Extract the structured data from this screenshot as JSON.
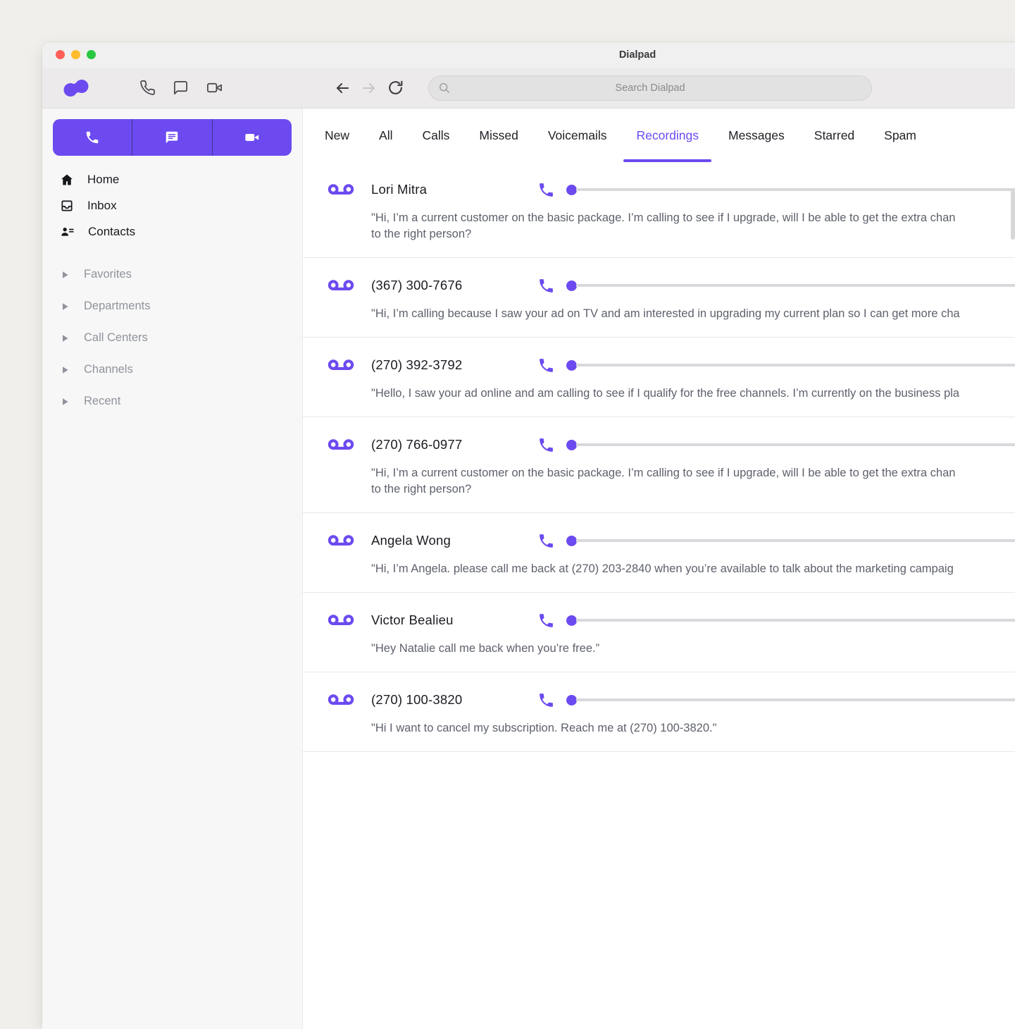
{
  "window": {
    "title": "Dialpad"
  },
  "toolbar": {
    "search_placeholder": "Search Dialpad",
    "icons": [
      "phone-icon",
      "chat-icon",
      "video-icon"
    ],
    "nav_icons": [
      "back-arrow-icon",
      "forward-arrow-icon",
      "refresh-icon"
    ]
  },
  "sidebar": {
    "segmented_icons": [
      "phone-icon",
      "chat-icon",
      "video-icon"
    ],
    "nav": [
      {
        "label": "Home",
        "icon": "home-icon"
      },
      {
        "label": "Inbox",
        "icon": "inbox-icon"
      },
      {
        "label": "Contacts",
        "icon": "contacts-icon"
      }
    ],
    "sections": [
      "Favorites",
      "Departments",
      "Call Centers",
      "Channels",
      "Recent"
    ]
  },
  "tabs": {
    "items": [
      "New",
      "All",
      "Calls",
      "Missed",
      "Voicemails",
      "Recordings",
      "Messages",
      "Starred",
      "Spam"
    ],
    "active": "Recordings"
  },
  "recordings": [
    {
      "title": "Lori Mitra",
      "transcript_lines": [
        "\"Hi, I’m a current customer on the basic package. I’m calling to see if I upgrade, will I be able to get the extra chan",
        "to the right person?"
      ]
    },
    {
      "title": "(367) 300-7676",
      "transcript_lines": [
        "\"Hi, I’m calling because I saw your ad on TV and am interested in upgrading my current plan so I can get more cha"
      ]
    },
    {
      "title": "(270) 392-3792",
      "transcript_lines": [
        "\"Hello, I saw your ad online and am calling to see if I qualify for the free channels. I’m currently on the business pla"
      ]
    },
    {
      "title": "(270) 766-0977",
      "transcript_lines": [
        "\"Hi, I’m a current customer on the basic package. I’m calling to see if I upgrade, will I be able to get the extra chan",
        "to the right person?"
      ]
    },
    {
      "title": "Angela Wong",
      "transcript_lines": [
        "\"Hi, I’m Angela. please call me back at (270) 203-2840 when you’re available to talk about the marketing campaig"
      ]
    },
    {
      "title": "Victor Bealieu",
      "transcript_lines": [
        "\"Hey Natalie call me back when you’re free.”"
      ]
    },
    {
      "title": "(270) 100-3820",
      "transcript_lines": [
        "\"Hi I want to cancel my subscription. Reach me at (270) 100-3820.\""
      ]
    }
  ],
  "colors": {
    "accent": "#6c4af0",
    "traffic_lights": [
      "#ff5f57",
      "#febc2e",
      "#28c840"
    ],
    "slider_track": "#d9d8dc",
    "transcript_text": "#5d616b"
  }
}
